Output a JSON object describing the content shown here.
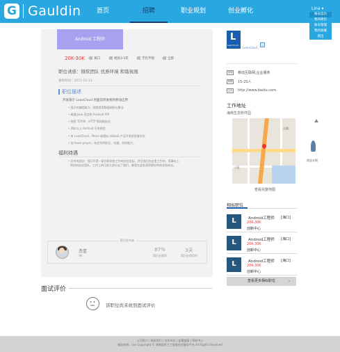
{
  "header": {
    "logo_letter": "G",
    "brand": "Gauldin",
    "nav": [
      "首页",
      "招聘",
      "职业规划",
      "创业孵化"
    ],
    "user": "Lina",
    "user_menu": [
      "账号首页",
      "我的简历",
      "账号管理",
      "我的收藏",
      "退出"
    ]
  },
  "job": {
    "title": "Android 工程师",
    "salary": "20K-30K",
    "location": "海口",
    "experience": "经验3-5年",
    "education": "学历不限",
    "type": "全职",
    "allure": "职位诱惑：微软团队 优质环境 和谐氛围",
    "publish_time": "发布时间：2015-11-13",
    "desc_title": "职位描述",
    "desc_intro": "开发基于 LeanCloud 的面向开发者的移动应用",
    "desc_bullets": [
      "强大的编程能力，熟悉常用数据结构与算法",
      "精通 Java 语言和 Android API",
      "熟悉 TCP/IP、HTTP 等网络协议",
      "两年以上 Android 开发经验",
      "有 LeanCloud、Parse 或相似 mBaaS 产品开发经验者优先",
      "加 team player，有优秀的职业、沟通、协作能力。"
    ],
    "benefit_title": "福利待遇",
    "benefit_text_1": "优秀的团队：我们不是一家在职场里工作的创业团队，并且我们在这里工作的，而事实上",
    "benefit_text_2": "和别的创业团队，工作上的已经大部分走了我们，都是在此处获得更好的体验和成长。"
  },
  "publisher": {
    "label": "职位发布者",
    "name": "杰佳",
    "role": "HR",
    "rate": "87%",
    "rate_label": "简历处理率",
    "days": "3天",
    "days_label": "简历处理用时"
  },
  "interview": {
    "title": "面试评价",
    "empty_text": "该职位尚未收到面试评价"
  },
  "company": {
    "logo_letter": "L",
    "logo_text": "LeanCloud",
    "name": "LeanCloud",
    "badge": "认",
    "field": "移动互联网,企业服务",
    "size": "15-20人",
    "site": "http://www.baidu.com",
    "field_icon": "领域",
    "size_icon": "规模",
    "site_icon": "主页"
  },
  "work_address": {
    "title": "工作地址",
    "address": "海南生态软件园",
    "map_caption": "查看完整地图",
    "map_label_1": "小区",
    "map_label_2": "公园"
  },
  "related": {
    "title": "相似职位",
    "items": [
      {
        "name": "Android工程师",
        "salary": "20K-30K",
        "company": "创新中心",
        "location": "[海口]",
        "logo": "L"
      },
      {
        "name": "Android工程师",
        "salary": "20K-30K",
        "company": "创新中心",
        "location": "[海口]",
        "logo": "L"
      },
      {
        "name": "Android工程师",
        "salary": "20K-30K",
        "company": "创新中心",
        "location": "[海口]",
        "logo": "L"
      }
    ],
    "more": "查看更多相似职位",
    "more_arrow": "›"
  },
  "float": {
    "label": "创业计划"
  },
  "footer": {
    "line1": "公司简介 | 联系我们 | 合作伙伴 | 友情链接 | 帮助中心",
    "line2": "服务热线：xxx    Copyright © 海南国贸兰工智能创业服务平台 All Rights Reserved"
  }
}
